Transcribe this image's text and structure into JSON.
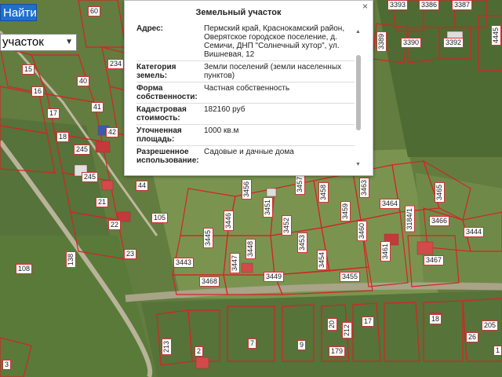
{
  "toolbar": {
    "find_label": "Найти",
    "object_type": "участок"
  },
  "popup": {
    "title": "Земельный участок",
    "close_symbol": "×",
    "rows": [
      {
        "key": "Адрес:",
        "value": "Пермский край, Краснокамский район, Оверятское городское поселение, д. Семичи, ДНП \"Солнечный хутор\", ул. Вишневая, 12"
      },
      {
        "key": "Категория земель:",
        "value": "Земли поселений (земли населенных пунктов)"
      },
      {
        "key": "Форма собственности:",
        "value": "Частная собственность"
      },
      {
        "key": "Кадастровая стоимость:",
        "value": "182160 руб"
      },
      {
        "key": "Уточненная площадь:",
        "value": "1000 кв.м"
      },
      {
        "key": "Разрешенное использование:",
        "value": "Садовые и дачные дома"
      }
    ]
  },
  "map": {
    "parcel_labels": [
      "60",
      "234",
      "15",
      "40",
      "16",
      "41",
      "17",
      "42",
      "18",
      "245",
      "245",
      "44",
      "21",
      "105",
      "22",
      "23",
      "108",
      "138",
      "3",
      "3443",
      "3468",
      "3446",
      "3445",
      "3447",
      "3448",
      "3449",
      "3451",
      "3452",
      "3453",
      "3454",
      "3455",
      "3456",
      "3457",
      "3458",
      "3459",
      "3460",
      "3461",
      "3463",
      "3464",
      "3465",
      "3466",
      "3444",
      "3467",
      "3184/1",
      "3393",
      "3386",
      "3387",
      "3389",
      "3390",
      "3392",
      "4445",
      "3",
      "213",
      "2",
      "7",
      "9",
      "179",
      "20",
      "17",
      "212",
      "18",
      "205",
      "26",
      "1"
    ]
  },
  "colors": {
    "find_button": "#1e6fd0",
    "parcel_border": "#cc2222"
  }
}
